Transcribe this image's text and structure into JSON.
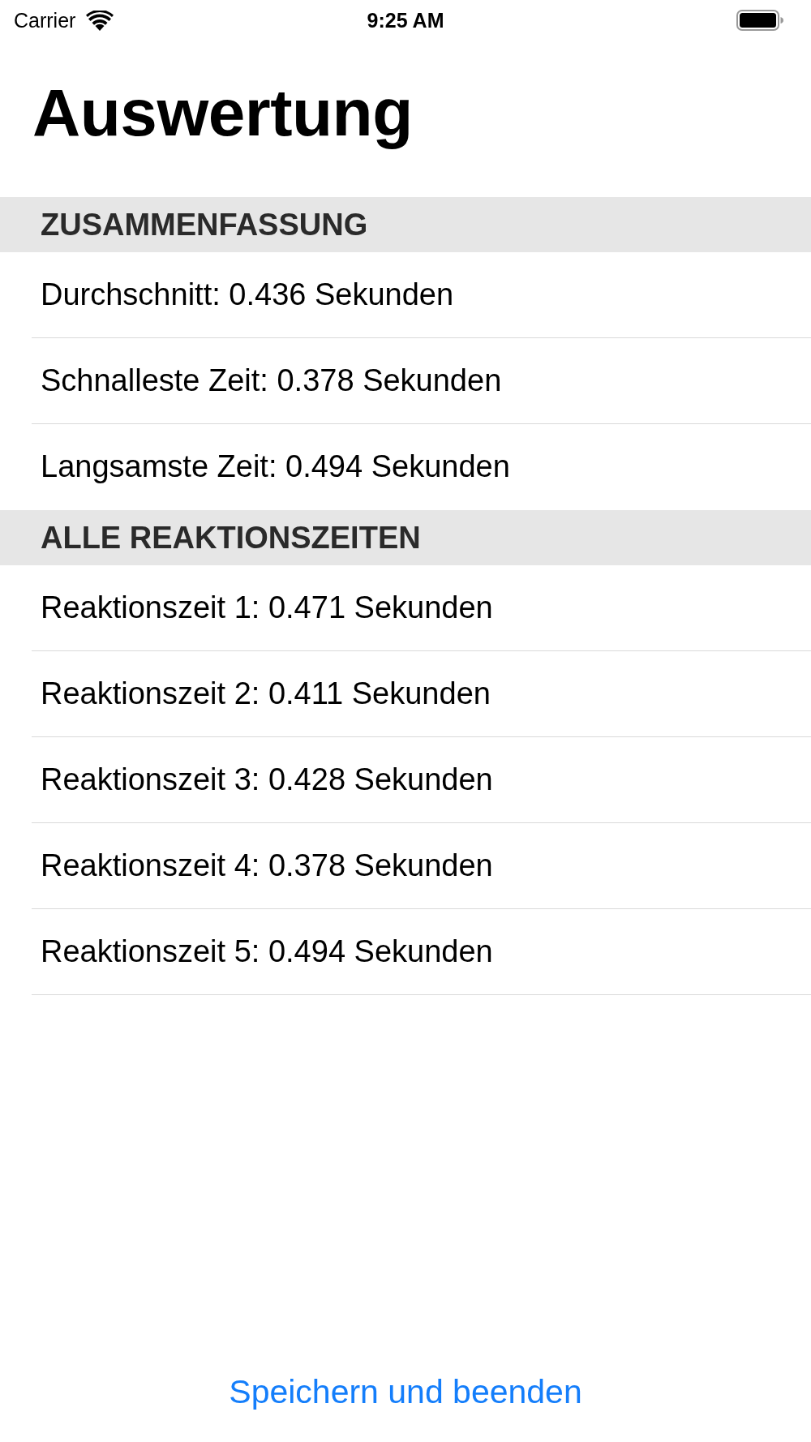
{
  "status_bar": {
    "carrier": "Carrier",
    "time": "9:25 AM"
  },
  "title": "Auswertung",
  "sections": [
    {
      "header": "ZUSAMMENFASSUNG",
      "rows": [
        "Durchschnitt: 0.436 Sekunden",
        "Schnalleste Zeit: 0.378 Sekunden",
        "Langsamste Zeit: 0.494 Sekunden"
      ]
    },
    {
      "header": "ALLE REAKTIONSZEITEN",
      "rows": [
        "Reaktionszeit 1: 0.471 Sekunden",
        "Reaktionszeit 2: 0.411 Sekunden",
        "Reaktionszeit 3: 0.428 Sekunden",
        "Reaktionszeit 4: 0.378 Sekunden",
        "Reaktionszeit 5: 0.494 Sekunden"
      ]
    }
  ],
  "button": {
    "label": "Speichern und beenden"
  }
}
